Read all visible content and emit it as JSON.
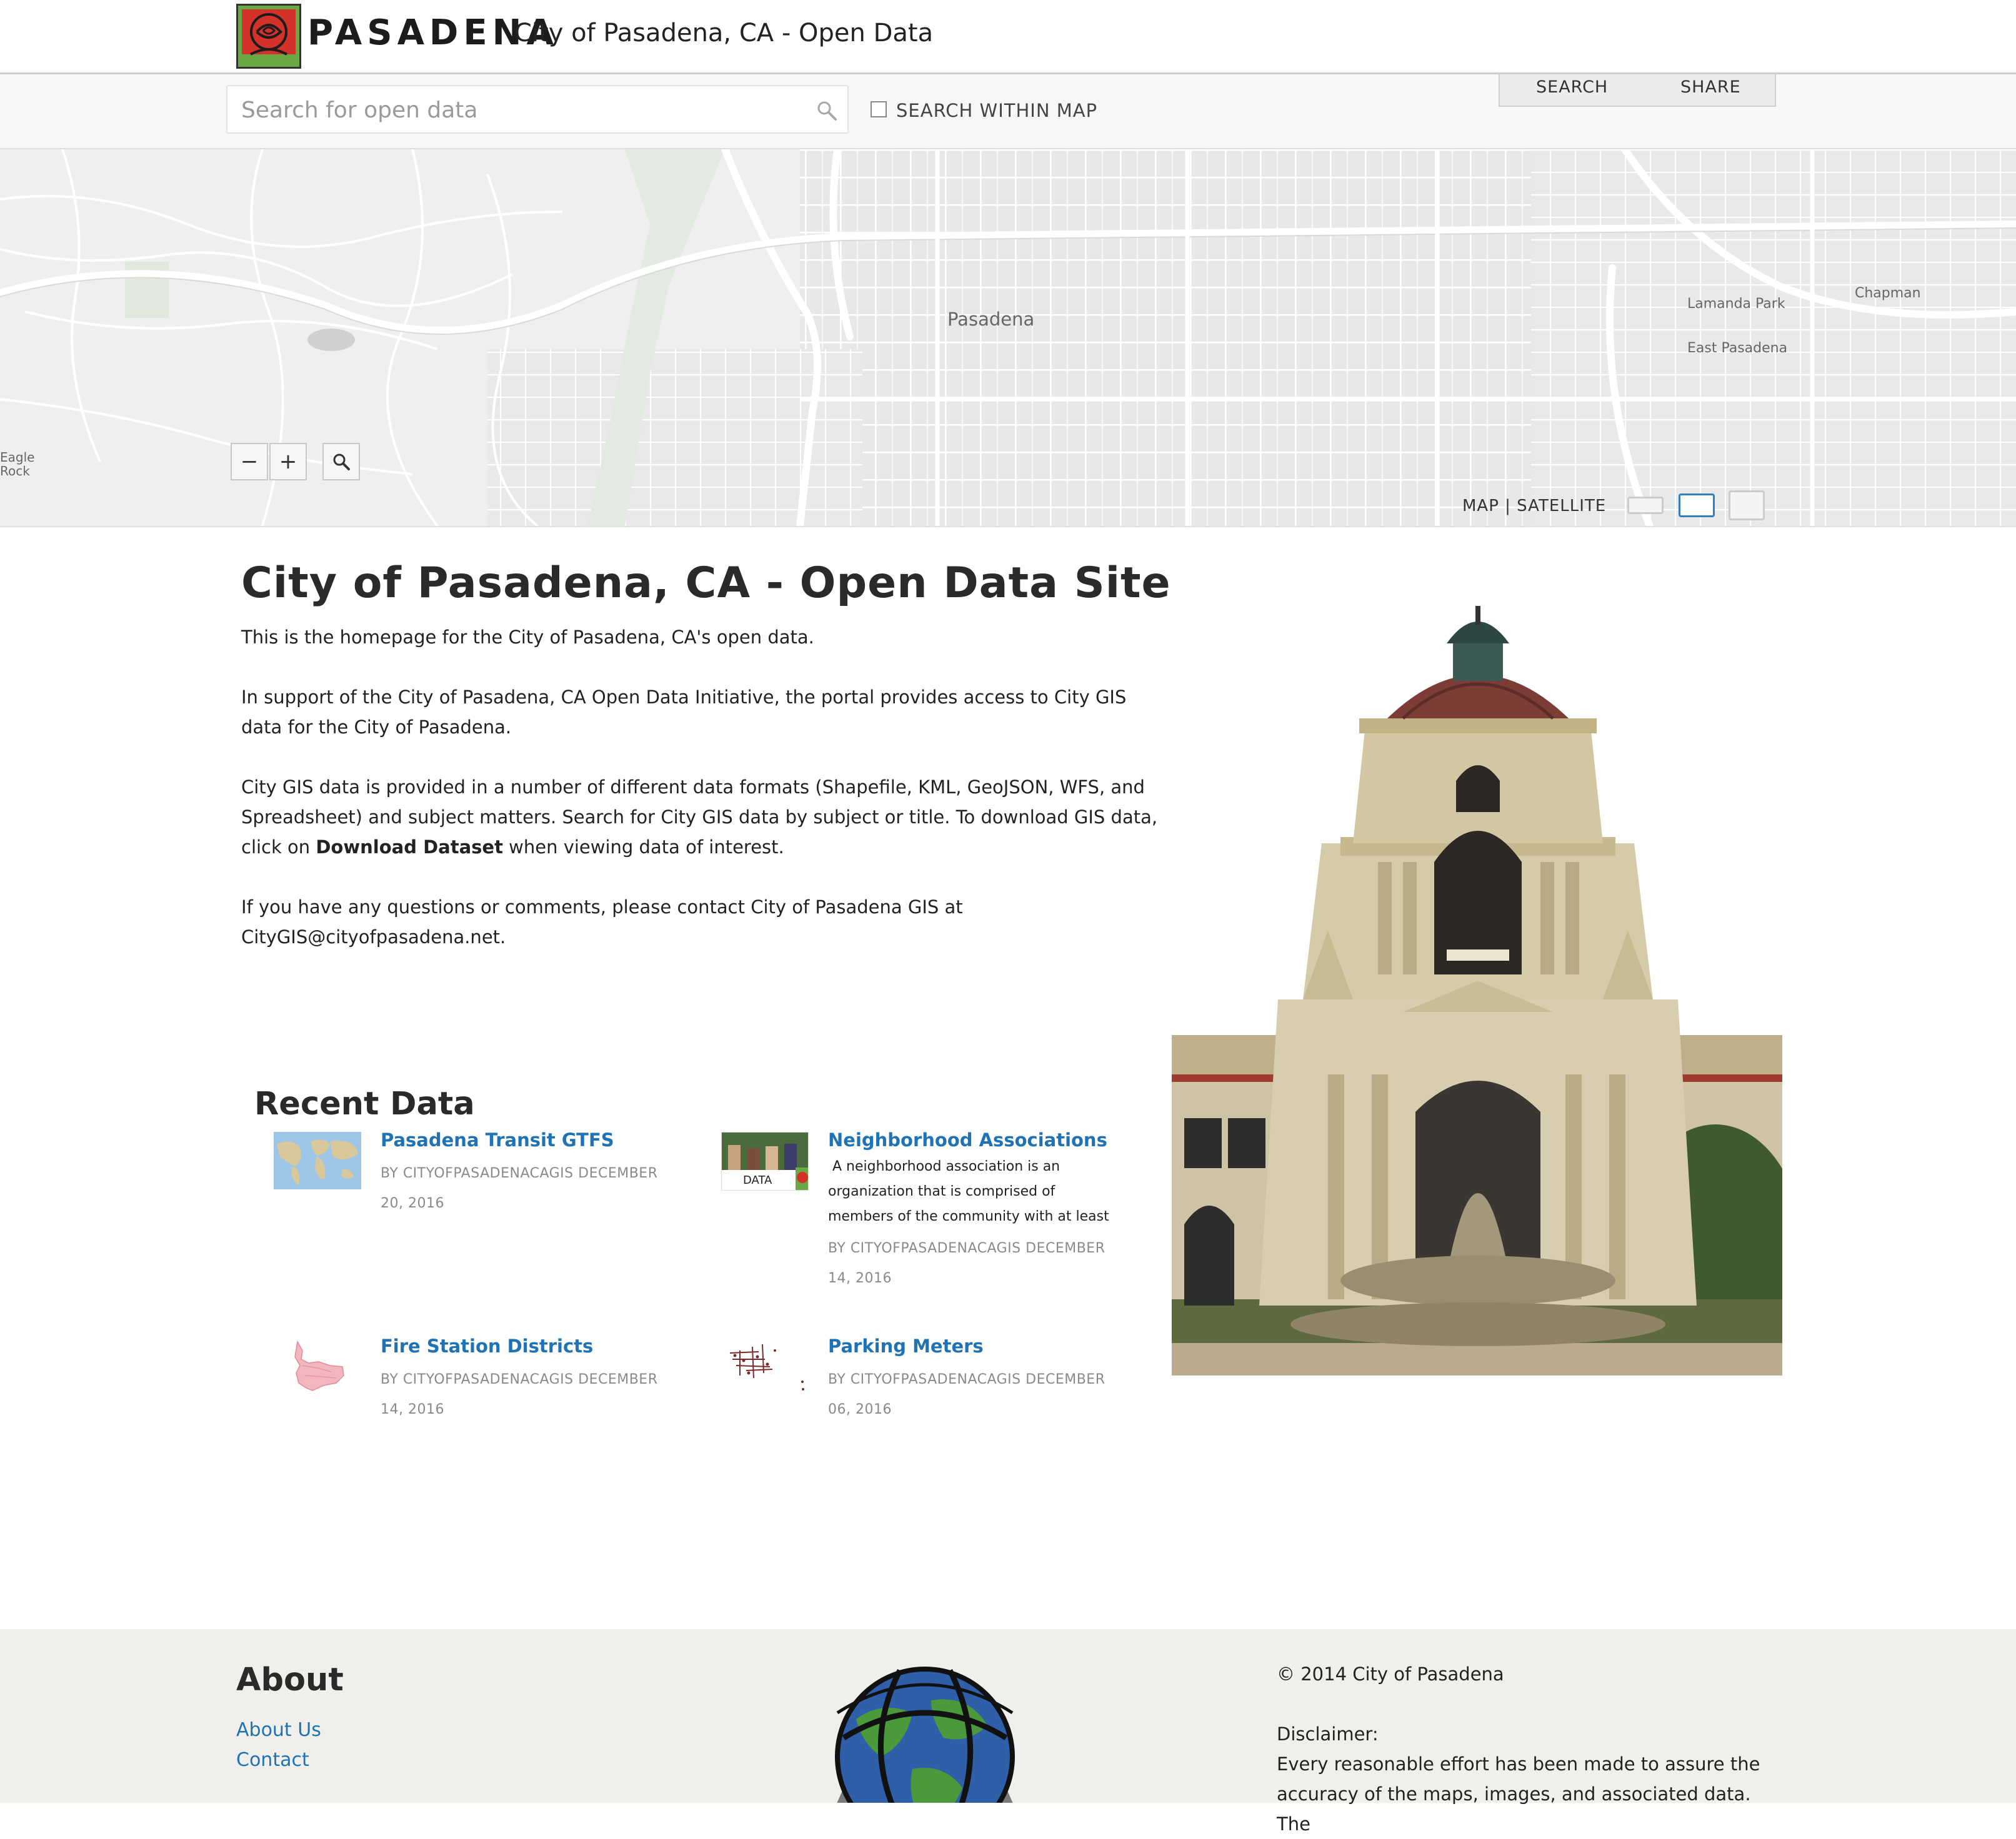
{
  "header": {
    "logo_text": "PASADENA",
    "site_title": "City of Pasadena, CA - Open Data"
  },
  "search": {
    "placeholder": "Search for open data",
    "value": "",
    "within_map_label": "SEARCH WITHIN MAP",
    "within_map_checked": false
  },
  "tabs": [
    {
      "label": "SEARCH"
    },
    {
      "label": "SHARE"
    }
  ],
  "map": {
    "place_labels": {
      "pasadena": "Pasadena",
      "lamanda_park": "Lamanda Park",
      "chapman": "Chapman",
      "east_pasadena": "East Pasadena",
      "eagle": "Eagle",
      "rock": "Rock"
    },
    "zoom_out": "−",
    "zoom_in": "+",
    "map_type_label": "MAP | SATELLITE"
  },
  "intro": {
    "title": "City of Pasadena, CA - Open Data Site",
    "p1": "This is the homepage for the City of Pasadena, CA's open data.",
    "p2": "In support of the City of Pasadena, CA Open Data Initiative, the portal provides access to City GIS data for the City of Pasadena.",
    "p3_before": "City GIS data is provided in a number of different data formats (Shapefile, KML, GeoJSON, WFS, and Spreadsheet) and subject matters. Search for City GIS data by subject or title. To download GIS data, click on ",
    "p3_bold": "Download Dataset",
    "p3_after": " when viewing data of interest.",
    "p4": "If you have any questions or comments, please contact City of Pasadena GIS at CityGIS@cityofpasadena.net."
  },
  "recent": {
    "heading": "Recent Data",
    "items": [
      {
        "title": "Pasadena Transit GTFS",
        "description": "",
        "meta": "BY CITYOFPASADENACAGIS DECEMBER 20, 2016"
      },
      {
        "title": "Neighborhood Associations",
        "description": " A neighborhood association is an organization that is comprised of members of the community with at least",
        "meta": "BY CITYOFPASADENACAGIS DECEMBER 14, 2016"
      },
      {
        "title": "Fire Station Districts",
        "description": "",
        "meta": "BY CITYOFPASADENACAGIS DECEMBER 14, 2016"
      },
      {
        "title": "Parking Meters",
        "description": "",
        "meta": "BY CITYOFPASADENACAGIS DECEMBER 06, 2016"
      }
    ],
    "thumb_data_label": "DATA"
  },
  "footer": {
    "about_heading": "About",
    "links": [
      {
        "label": "About Us"
      },
      {
        "label": "Contact"
      }
    ],
    "copyright": "© 2014 City of Pasadena",
    "disclaimer_heading": "Disclaimer:",
    "disclaimer_text": "Every reasonable effort has been made to assure the accuracy of the maps, images, and associated data. The"
  },
  "colors": {
    "link": "#1f73b4",
    "header_border": "#cfcfcf",
    "footer_bg": "#f0efeb",
    "map_bg": "#efefef",
    "logo_green": "#6aa843",
    "logo_red": "#d3322a"
  }
}
